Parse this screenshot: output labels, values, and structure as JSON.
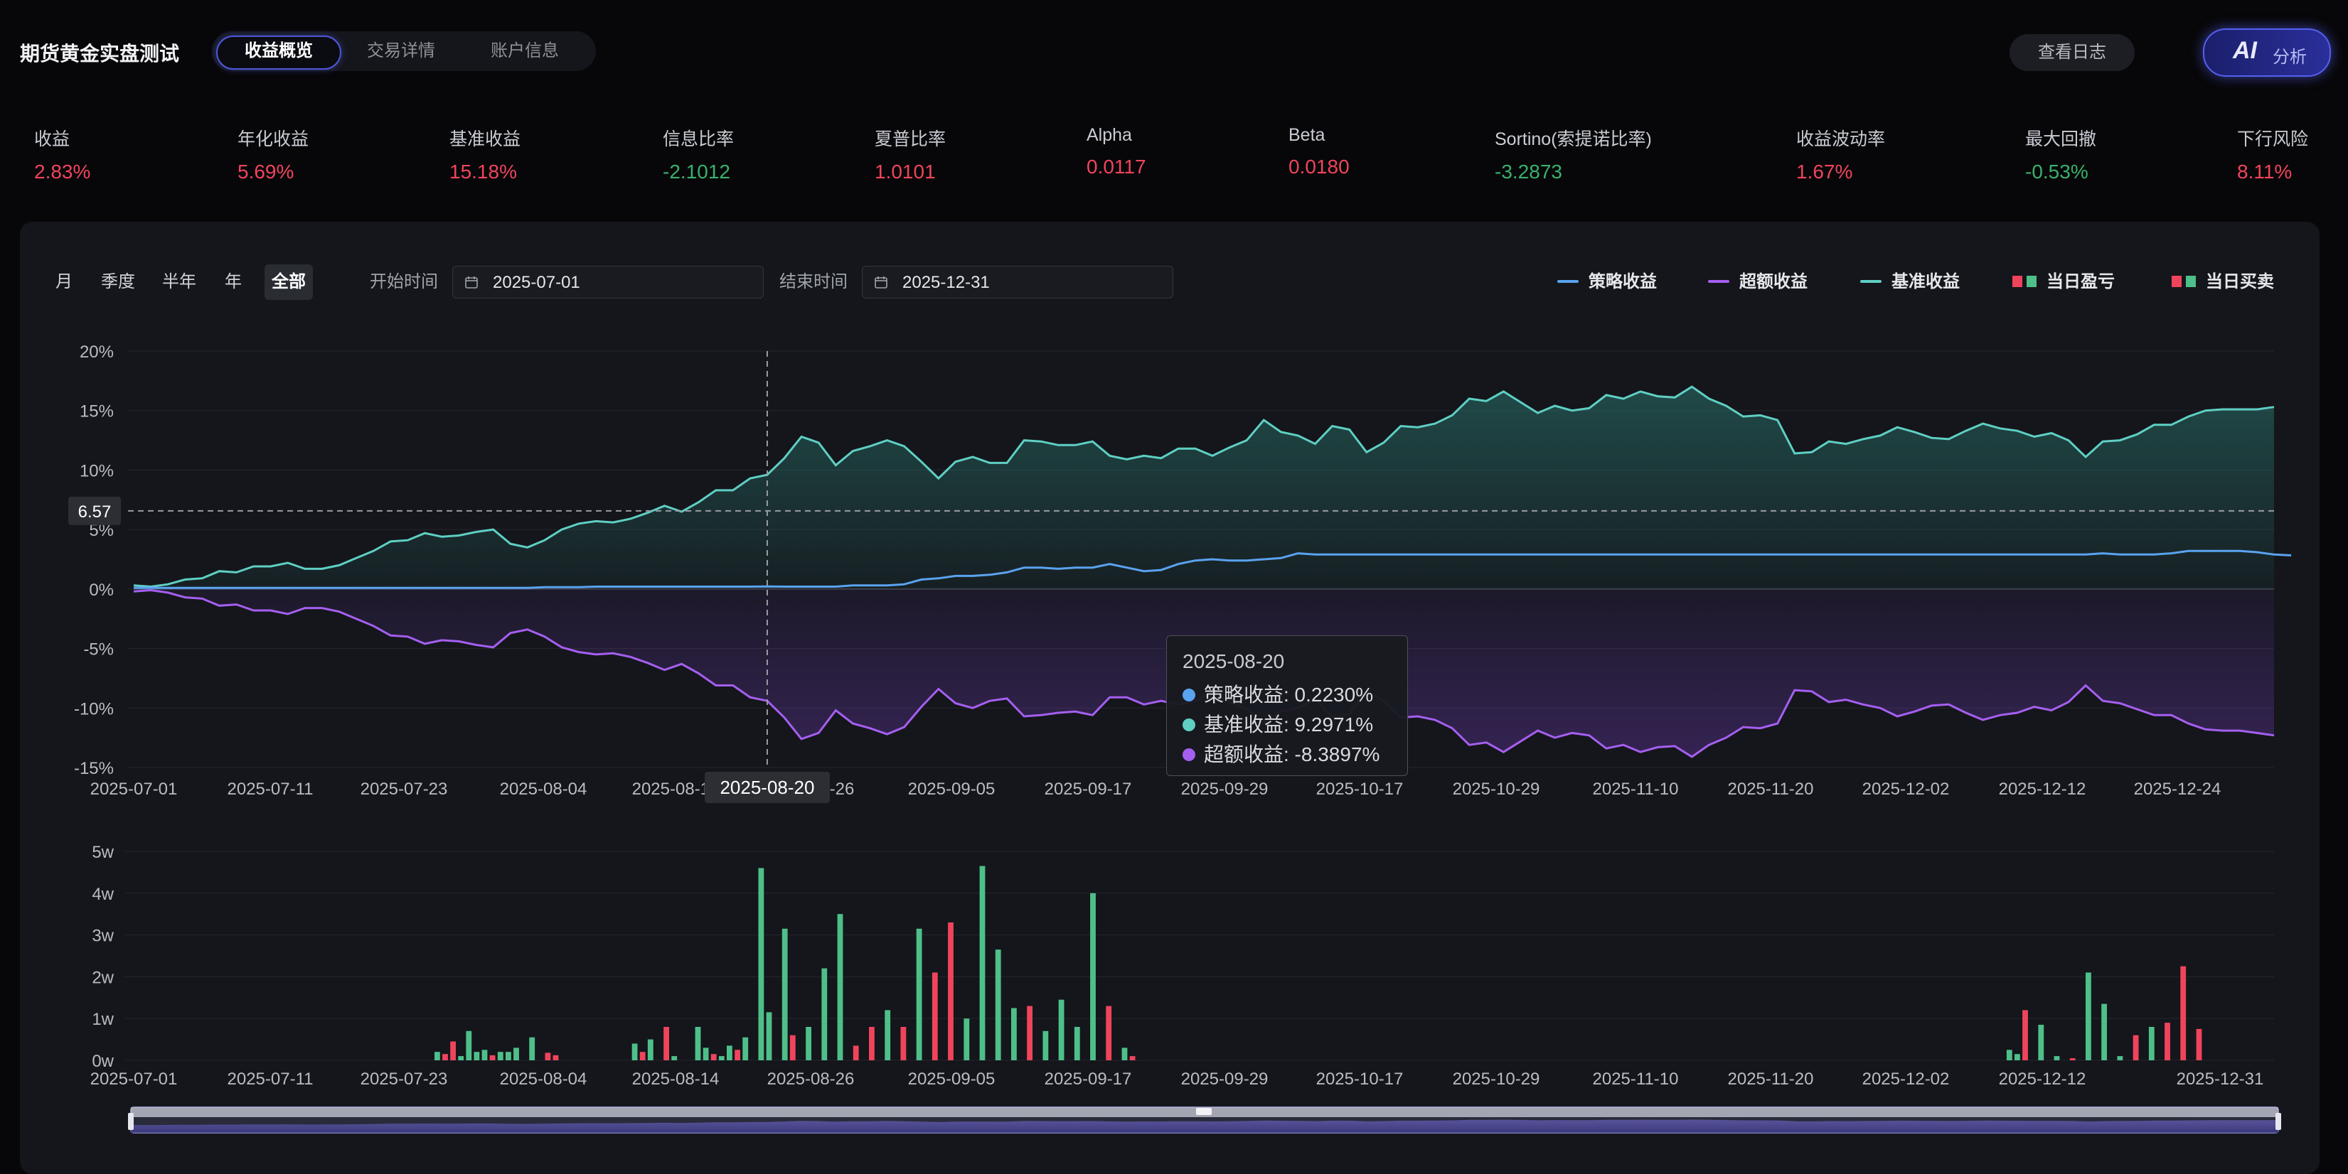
{
  "header": {
    "app_title": "期货黄金实盘测试",
    "tabs": [
      {
        "label": "收益概览",
        "active": true
      },
      {
        "label": "交易详情",
        "active": false
      },
      {
        "label": "账户信息",
        "active": false
      }
    ],
    "log_button": "查看日志",
    "ai_button": {
      "main": "AI",
      "sub": "分析"
    }
  },
  "metrics": [
    {
      "label": "收益",
      "value": "2.83%",
      "tone": "red"
    },
    {
      "label": "年化收益",
      "value": "5.69%",
      "tone": "red"
    },
    {
      "label": "基准收益",
      "value": "15.18%",
      "tone": "red"
    },
    {
      "label": "信息比率",
      "value": "-2.1012",
      "tone": "green"
    },
    {
      "label": "夏普比率",
      "value": "1.0101",
      "tone": "red"
    },
    {
      "label": "Alpha",
      "value": "0.0117",
      "tone": "red"
    },
    {
      "label": "Beta",
      "value": "0.0180",
      "tone": "red"
    },
    {
      "label": "Sortino(索提诺比率)",
      "value": "-3.2873",
      "tone": "green"
    },
    {
      "label": "收益波动率",
      "value": "1.67%",
      "tone": "red"
    },
    {
      "label": "最大回撤",
      "value": "-0.53%",
      "tone": "green"
    },
    {
      "label": "下行风险",
      "value": "8.11%",
      "tone": "red"
    }
  ],
  "controls": {
    "periods": [
      {
        "label": "月",
        "active": false
      },
      {
        "label": "季度",
        "active": false
      },
      {
        "label": "半年",
        "active": false
      },
      {
        "label": "年",
        "active": false
      },
      {
        "label": "全部",
        "active": true
      }
    ],
    "start_label": "开始时间",
    "start_value": "2025-07-01",
    "end_label": "结束时间",
    "end_value": "2025-12-31"
  },
  "legend": [
    {
      "label": "策略收益",
      "kind": "line",
      "color": "#5aa3f0"
    },
    {
      "label": "超额收益",
      "kind": "line",
      "color": "#a55ff0"
    },
    {
      "label": "基准收益",
      "kind": "line",
      "color": "#5fcfc4"
    },
    {
      "label": "当日盈亏",
      "kind": "squares",
      "colors": [
        "#f0445c",
        "#4fbf8a"
      ]
    },
    {
      "label": "当日买卖",
      "kind": "squares",
      "colors": [
        "#f0445c",
        "#4fbf8a"
      ]
    }
  ],
  "colors": {
    "strategy": "#5aa3f0",
    "excess": "#a55ff0",
    "benchmark": "#5fcfc4",
    "up": "#f0445c",
    "down": "#4fbf8a"
  },
  "tooltip": {
    "date": "2025-08-20",
    "rows": [
      {
        "text": "策略收益: 0.2230%",
        "color": "#5aa3f0"
      },
      {
        "text": "基准收益: 9.2971%",
        "color": "#5fcfc4"
      },
      {
        "text": "超额收益: -8.3897%",
        "color": "#a55ff0"
      }
    ]
  },
  "crosshair": {
    "y_value": "6.57",
    "x_label": "2025-08-20"
  },
  "chart_data": [
    {
      "type": "line",
      "ylim": [
        -15,
        20
      ],
      "y_ticks": [
        "20%",
        "15%",
        "10%",
        "5%",
        "0%",
        "-5%",
        "-10%",
        "-15%"
      ],
      "x_ticks": [
        "2025-07-01",
        "2025-07-11",
        "2025-07-23",
        "2025-08-04",
        "2025-08-14",
        "2025-08-26",
        "2025-09-05",
        "2025-09-17",
        "2025-09-29",
        "2025-10-17",
        "2025-10-29",
        "2025-11-10",
        "2025-11-20",
        "2025-12-02",
        "2025-12-12",
        "2025-12-24"
      ],
      "series": [
        {
          "name": "基准收益",
          "key": "benchmark",
          "values": [
            0.3,
            0.2,
            0.4,
            0.8,
            0.9,
            1.5,
            1.4,
            1.9,
            1.9,
            2.2,
            1.7,
            1.7,
            2.0,
            2.6,
            3.2,
            4.0,
            4.1,
            4.7,
            4.4,
            4.5,
            4.8,
            5.0,
            3.8,
            3.5,
            4.1,
            5.0,
            5.5,
            5.7,
            5.6,
            5.9,
            6.4,
            7.0,
            6.5,
            7.3,
            8.3,
            8.3,
            9.3,
            9.6,
            11.0,
            12.8,
            12.3,
            10.4,
            11.6,
            12.0,
            12.5,
            12.0,
            10.7,
            9.3,
            10.7,
            11.1,
            10.6,
            10.6,
            12.5,
            12.4,
            12.1,
            12.1,
            12.4,
            11.2,
            10.9,
            11.2,
            11.0,
            11.8,
            11.8,
            11.2,
            11.9,
            12.5,
            14.2,
            13.2,
            12.9,
            12.2,
            13.7,
            13.4,
            11.5,
            12.3,
            13.7,
            13.6,
            13.9,
            14.6,
            16.0,
            15.8,
            16.6,
            15.7,
            14.8,
            15.4,
            15.0,
            15.2,
            16.3,
            16.0,
            16.6,
            16.2,
            16.1,
            17.0,
            16.0,
            15.4,
            14.5,
            14.6,
            14.2,
            11.4,
            11.5,
            12.4,
            12.2,
            12.6,
            12.9,
            13.6,
            13.2,
            12.7,
            12.6,
            13.3,
            13.9,
            13.5,
            13.3,
            12.8,
            13.1,
            12.5,
            11.1,
            12.4,
            12.5,
            13.0,
            13.8,
            13.8,
            14.5,
            15.0,
            15.1,
            15.1,
            15.1,
            15.3
          ]
        },
        {
          "name": "策略收益",
          "key": "strategy",
          "values": [
            0.1,
            0.1,
            0.1,
            0.1,
            0.1,
            0.1,
            0.1,
            0.1,
            0.1,
            0.1,
            0.1,
            0.1,
            0.1,
            0.1,
            0.1,
            0.1,
            0.1,
            0.1,
            0.1,
            0.1,
            0.1,
            0.1,
            0.1,
            0.1,
            0.15,
            0.15,
            0.15,
            0.2,
            0.2,
            0.2,
            0.2,
            0.2,
            0.2,
            0.2,
            0.2,
            0.2,
            0.2,
            0.22,
            0.2,
            0.2,
            0.2,
            0.2,
            0.3,
            0.3,
            0.3,
            0.4,
            0.8,
            0.9,
            1.1,
            1.1,
            1.2,
            1.4,
            1.8,
            1.8,
            1.7,
            1.8,
            1.8,
            2.1,
            1.8,
            1.5,
            1.6,
            2.1,
            2.4,
            2.5,
            2.4,
            2.4,
            2.5,
            2.6,
            3.0,
            2.9,
            2.9,
            2.9,
            2.9,
            2.9,
            2.9,
            2.9,
            2.9,
            2.9,
            2.9,
            2.9,
            2.9,
            2.9,
            2.9,
            2.9,
            2.9,
            2.9,
            2.9,
            2.9,
            2.9,
            2.9,
            2.9,
            2.9,
            2.9,
            2.9,
            2.9,
            2.9,
            2.9,
            2.9,
            2.9,
            2.9,
            2.9,
            2.9,
            2.9,
            2.9,
            2.9,
            2.9,
            2.9,
            2.9,
            2.9,
            2.9,
            2.9,
            2.9,
            2.9,
            2.9,
            2.9,
            3.0,
            2.9,
            2.9,
            2.9,
            3.0,
            3.2,
            3.2,
            3.2,
            3.2,
            3.1,
            2.9,
            2.83
          ]
        },
        {
          "name": "超额收益",
          "key": "excess",
          "values": [
            -0.2,
            -0.1,
            -0.3,
            -0.7,
            -0.8,
            -1.4,
            -1.3,
            -1.8,
            -1.8,
            -2.1,
            -1.6,
            -1.6,
            -1.9,
            -2.5,
            -3.1,
            -3.9,
            -4.0,
            -4.6,
            -4.3,
            -4.4,
            -4.7,
            -4.9,
            -3.7,
            -3.4,
            -4.0,
            -4.9,
            -5.3,
            -5.5,
            -5.4,
            -5.7,
            -6.2,
            -6.8,
            -6.3,
            -7.1,
            -8.1,
            -8.1,
            -9.1,
            -9.4,
            -10.8,
            -12.6,
            -12.1,
            -10.2,
            -11.3,
            -11.7,
            -12.2,
            -11.6,
            -9.9,
            -8.4,
            -9.6,
            -10.0,
            -9.4,
            -9.2,
            -10.7,
            -10.6,
            -10.4,
            -10.3,
            -10.6,
            -9.1,
            -9.1,
            -9.7,
            -9.4,
            -9.7,
            -9.4,
            -8.7,
            -9.5,
            -10.1,
            -11.2,
            -10.3,
            -10.0,
            -9.3,
            -10.8,
            -10.5,
            -8.6,
            -9.4,
            -10.8,
            -10.7,
            -11.0,
            -11.7,
            -13.1,
            -12.9,
            -13.7,
            -12.8,
            -11.9,
            -12.5,
            -12.1,
            -12.3,
            -13.4,
            -13.1,
            -13.7,
            -13.3,
            -13.2,
            -14.1,
            -13.1,
            -12.5,
            -11.6,
            -11.7,
            -11.3,
            -8.5,
            -8.6,
            -9.5,
            -9.3,
            -9.7,
            -10.0,
            -10.7,
            -10.3,
            -9.8,
            -9.7,
            -10.4,
            -11.0,
            -10.6,
            -10.4,
            -9.9,
            -10.2,
            -9.5,
            -8.1,
            -9.4,
            -9.6,
            -10.1,
            -10.6,
            -10.6,
            -11.3,
            -11.8,
            -11.9,
            -11.9,
            -12.1,
            -12.3
          ]
        }
      ]
    },
    {
      "type": "bar",
      "y_unit": "w",
      "ylim": [
        0,
        5
      ],
      "y_ticks": [
        "5w",
        "4w",
        "3w",
        "2w",
        "1w",
        "0w"
      ],
      "x_ticks": [
        "2025-07-01",
        "2025-07-11",
        "2025-07-23",
        "2025-08-04",
        "2025-08-14",
        "2025-08-26",
        "2025-09-05",
        "2025-09-17",
        "2025-09-29",
        "2025-10-17",
        "2025-10-29",
        "2025-11-10",
        "2025-11-20",
        "2025-12-02",
        "2025-12-12",
        "2025-12-31"
      ],
      "bars": [
        {
          "i": 39,
          "v": 0.2,
          "d": "down"
        },
        {
          "i": 40,
          "v": 0.15,
          "d": "up"
        },
        {
          "i": 41,
          "v": 0.45,
          "d": "up"
        },
        {
          "i": 42,
          "v": 0.1,
          "d": "down"
        },
        {
          "i": 43,
          "v": 0.7,
          "d": "down"
        },
        {
          "i": 44,
          "v": 0.2,
          "d": "down"
        },
        {
          "i": 45,
          "v": 0.25,
          "d": "down"
        },
        {
          "i": 46,
          "v": 0.12,
          "d": "up"
        },
        {
          "i": 47,
          "v": 0.2,
          "d": "down"
        },
        {
          "i": 48,
          "v": 0.2,
          "d": "down"
        },
        {
          "i": 49,
          "v": 0.3,
          "d": "down"
        },
        {
          "i": 51,
          "v": 0.55,
          "d": "down"
        },
        {
          "i": 53,
          "v": 0.18,
          "d": "up"
        },
        {
          "i": 54,
          "v": 0.12,
          "d": "up"
        },
        {
          "i": 64,
          "v": 0.4,
          "d": "down"
        },
        {
          "i": 65,
          "v": 0.2,
          "d": "up"
        },
        {
          "i": 66,
          "v": 0.5,
          "d": "down"
        },
        {
          "i": 68,
          "v": 0.8,
          "d": "up"
        },
        {
          "i": 69,
          "v": 0.1,
          "d": "down"
        },
        {
          "i": 72,
          "v": 0.8,
          "d": "down"
        },
        {
          "i": 73,
          "v": 0.3,
          "d": "down"
        },
        {
          "i": 74,
          "v": 0.15,
          "d": "up"
        },
        {
          "i": 75,
          "v": 0.1,
          "d": "down"
        },
        {
          "i": 76,
          "v": 0.35,
          "d": "down"
        },
        {
          "i": 77,
          "v": 0.25,
          "d": "up"
        },
        {
          "i": 78,
          "v": 0.55,
          "d": "down"
        },
        {
          "i": 80,
          "v": 4.6,
          "d": "down"
        },
        {
          "i": 81,
          "v": 1.15,
          "d": "down"
        },
        {
          "i": 83,
          "v": 3.15,
          "d": "down"
        },
        {
          "i": 84,
          "v": 0.6,
          "d": "up"
        },
        {
          "i": 86,
          "v": 0.8,
          "d": "down"
        },
        {
          "i": 88,
          "v": 2.2,
          "d": "down"
        },
        {
          "i": 90,
          "v": 3.5,
          "d": "down"
        },
        {
          "i": 92,
          "v": 0.35,
          "d": "up"
        },
        {
          "i": 94,
          "v": 0.8,
          "d": "up"
        },
        {
          "i": 96,
          "v": 1.2,
          "d": "down"
        },
        {
          "i": 98,
          "v": 0.8,
          "d": "up"
        },
        {
          "i": 100,
          "v": 3.15,
          "d": "down"
        },
        {
          "i": 102,
          "v": 2.1,
          "d": "up"
        },
        {
          "i": 104,
          "v": 3.3,
          "d": "up"
        },
        {
          "i": 106,
          "v": 1.0,
          "d": "down"
        },
        {
          "i": 108,
          "v": 4.65,
          "d": "down"
        },
        {
          "i": 110,
          "v": 2.65,
          "d": "down"
        },
        {
          "i": 112,
          "v": 1.25,
          "d": "down"
        },
        {
          "i": 114,
          "v": 1.3,
          "d": "up"
        },
        {
          "i": 116,
          "v": 0.7,
          "d": "down"
        },
        {
          "i": 118,
          "v": 1.45,
          "d": "down"
        },
        {
          "i": 120,
          "v": 0.8,
          "d": "down"
        },
        {
          "i": 122,
          "v": 4.0,
          "d": "down"
        },
        {
          "i": 124,
          "v": 1.3,
          "d": "up"
        },
        {
          "i": 126,
          "v": 0.3,
          "d": "down"
        },
        {
          "i": 127,
          "v": 0.1,
          "d": "up"
        },
        {
          "i": 238,
          "v": 0.25,
          "d": "down"
        },
        {
          "i": 239,
          "v": 0.15,
          "d": "down"
        },
        {
          "i": 240,
          "v": 1.2,
          "d": "up"
        },
        {
          "i": 242,
          "v": 0.85,
          "d": "down"
        },
        {
          "i": 244,
          "v": 0.1,
          "d": "down"
        },
        {
          "i": 246,
          "v": 0.05,
          "d": "up"
        },
        {
          "i": 248,
          "v": 2.1,
          "d": "down"
        },
        {
          "i": 250,
          "v": 1.35,
          "d": "down"
        },
        {
          "i": 252,
          "v": 0.1,
          "d": "down"
        },
        {
          "i": 254,
          "v": 0.6,
          "d": "up"
        },
        {
          "i": 256,
          "v": 0.8,
          "d": "down"
        },
        {
          "i": 258,
          "v": 0.9,
          "d": "up"
        },
        {
          "i": 260,
          "v": 2.25,
          "d": "up"
        },
        {
          "i": 262,
          "v": 0.75,
          "d": "up"
        }
      ]
    }
  ]
}
